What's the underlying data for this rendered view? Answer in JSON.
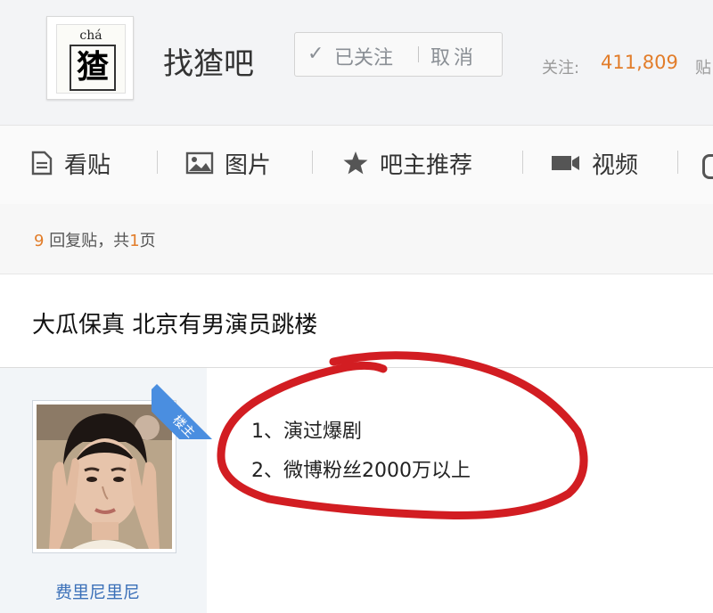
{
  "header": {
    "logo_pinyin": "chá",
    "logo_char": "猹",
    "forum_name": "找猹吧",
    "follow_label": "已关注",
    "cancel_label": "取消",
    "followers_label": "关注:",
    "followers_count": "411,809",
    "posts_label": "贴"
  },
  "nav": {
    "items": [
      {
        "label": "看贴",
        "icon": "document-icon"
      },
      {
        "label": "图片",
        "icon": "image-icon"
      },
      {
        "label": "吧主推荐",
        "icon": "star-icon"
      },
      {
        "label": "视频",
        "icon": "video-icon"
      }
    ]
  },
  "thread": {
    "reply_count": "9",
    "reply_text_mid": "回复贴，共",
    "page_count": "1",
    "reply_text_end": "页",
    "title": "大瓜保真 北京有男演员跳楼"
  },
  "post": {
    "owner_badge": "楼主",
    "author": "费里尼里尼",
    "lines": [
      "1、演过爆剧",
      "2、微博粉丝2000万以上"
    ]
  },
  "colors": {
    "accent_orange": "#e27d2a",
    "link_blue": "#3b70b8",
    "annotation_red": "#d21d22"
  }
}
